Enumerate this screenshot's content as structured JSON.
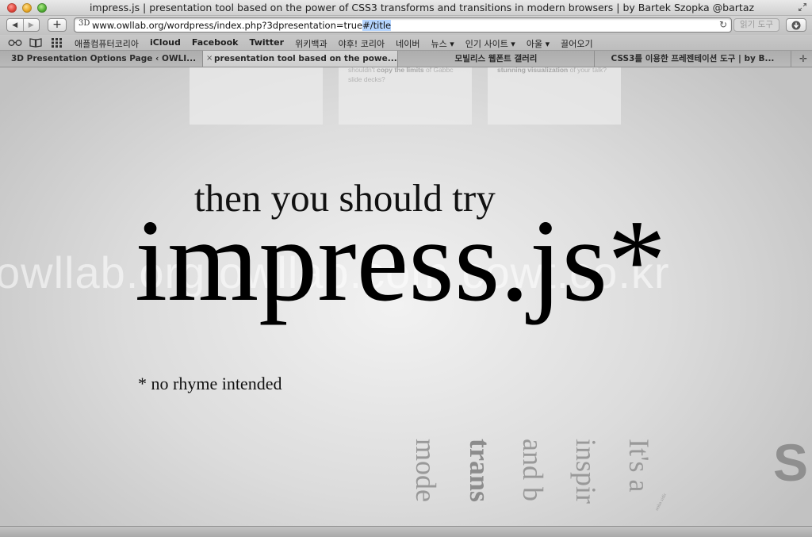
{
  "window": {
    "title": "impress.js | presentation tool based on the power of CSS3 transforms and transitions in modern browsers | by Bartek Szopka @bartaz"
  },
  "toolbar": {
    "back_icon": "back-arrow-icon",
    "forward_icon": "forward-arrow-icon",
    "add_label": "+",
    "address_favicon": "3D",
    "address_url_main": "www.owllab.org/wordpress/index.php?3dpresentation=true",
    "address_url_selected": "#/title",
    "reader_label": "읽기 도구"
  },
  "bookmarks": {
    "items": [
      {
        "label": "애플컴퓨터코리아"
      },
      {
        "label": "iCloud"
      },
      {
        "label": "Facebook"
      },
      {
        "label": "Twitter"
      },
      {
        "label": "위키백과"
      },
      {
        "label": "야후! 코리아"
      },
      {
        "label": "네이버"
      },
      {
        "label": "뉴스 ▾"
      },
      {
        "label": "인기 사이트 ▾"
      },
      {
        "label": "아울 ▾"
      },
      {
        "label": "끌어오기"
      }
    ]
  },
  "tabs": [
    {
      "label": "3D Presentation Options Page ‹ OWLI..."
    },
    {
      "label": "presentation tool based on the powe..."
    },
    {
      "label": "모빌리스 웹폰트 갤러리"
    },
    {
      "label": "CSS3를 이용한 프레젠테이션 도구 | by B..."
    }
  ],
  "content": {
    "card1_text": "",
    "card2_text_plain": "shouldn't ",
    "card2_text_bold": "copy the limits",
    "card2_text_rest": " of Gabbc slide decks?",
    "card3_text_bold": "stunning visualization",
    "card3_text_rest": " of your talk?",
    "watermark": "owllab.org owllab.com cowt.co.kr",
    "lead": "then you should try",
    "title": "impress.js*",
    "footnote": "* no rhyme intended",
    "vertical_words": [
      "It's a",
      "inspir",
      "and b",
      "trans",
      "mode"
    ],
    "tiny_rotated": "ooba sidir",
    "corner_letter": "S"
  },
  "colors": {
    "accent_selection": "#b5d5ff",
    "traffic_close": "#e0443a",
    "traffic_min": "#e9a624",
    "traffic_max": "#4fae32"
  }
}
